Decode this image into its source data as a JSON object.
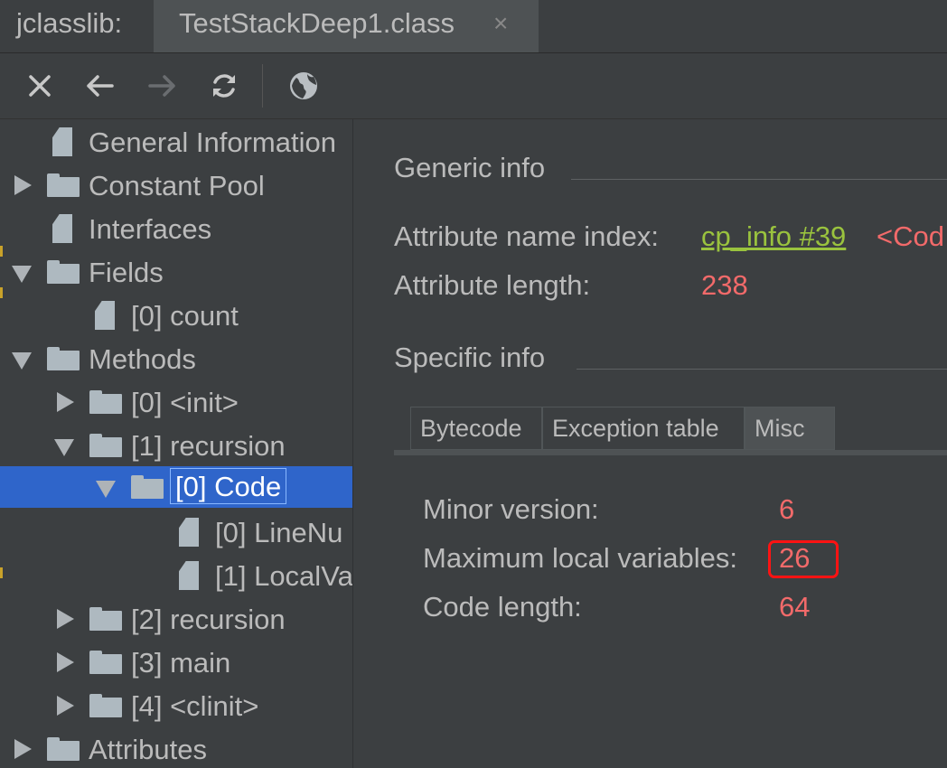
{
  "tabs": {
    "app_label": "jclasslib:",
    "file_title": "TestStackDeep1.class",
    "close_glyph": "×"
  },
  "toolbar": {
    "buttons": [
      {
        "icon": "close-icon"
      },
      {
        "icon": "back-arrow-icon"
      },
      {
        "icon": "forward-arrow-icon",
        "disabled": true
      },
      {
        "icon": "refresh-icon"
      },
      {
        "icon": "globe-icon"
      }
    ]
  },
  "tree": {
    "items": [
      {
        "label": "General Information",
        "type": "file",
        "expanded": null
      },
      {
        "label": "Constant Pool",
        "type": "folder",
        "expanded": false
      },
      {
        "label": "Interfaces",
        "type": "file",
        "expanded": null
      },
      {
        "label": "Fields",
        "type": "folder",
        "expanded": true
      },
      {
        "label": "[0] count",
        "type": "file",
        "expanded": null
      },
      {
        "label": "Methods",
        "type": "folder",
        "expanded": true
      },
      {
        "label": "[0] <init>",
        "type": "folder",
        "expanded": false
      },
      {
        "label": "[1] recursion",
        "type": "folder",
        "expanded": true
      },
      {
        "label": "[0] Code",
        "type": "folder",
        "expanded": true,
        "selected": true
      },
      {
        "label": "[0] LineNu",
        "type": "file",
        "expanded": null
      },
      {
        "label": "[1] LocalVa",
        "type": "file",
        "expanded": null
      },
      {
        "label": "[2] recursion",
        "type": "folder",
        "expanded": false
      },
      {
        "label": "[3] main",
        "type": "folder",
        "expanded": false
      },
      {
        "label": "[4] <clinit>",
        "type": "folder",
        "expanded": false
      },
      {
        "label": "Attributes",
        "type": "folder",
        "expanded": false
      }
    ]
  },
  "generic_info": {
    "title": "Generic info",
    "attr_name_index_label": "Attribute name index:",
    "attr_name_index_link": "cp_info #39",
    "attr_name_index_value": "<Cod",
    "attr_length_label": "Attribute length:",
    "attr_length_value": "238"
  },
  "specific_info": {
    "title": "Specific info",
    "tabs": [
      "Bytecode",
      "Exception table",
      "Misc"
    ],
    "active_tab": "Misc",
    "minor_version_label": "Minor version:",
    "minor_version_value": "6",
    "max_locals_label": "Maximum local variables:",
    "max_locals_value": "26",
    "code_length_label": "Code length:",
    "code_length_value": "64"
  },
  "colors": {
    "background": "#3c3f41",
    "selection": "#2f65ca",
    "value_red": "#f26a6a",
    "link_green": "#9ac33e",
    "highlight_border": "#ff1313"
  }
}
